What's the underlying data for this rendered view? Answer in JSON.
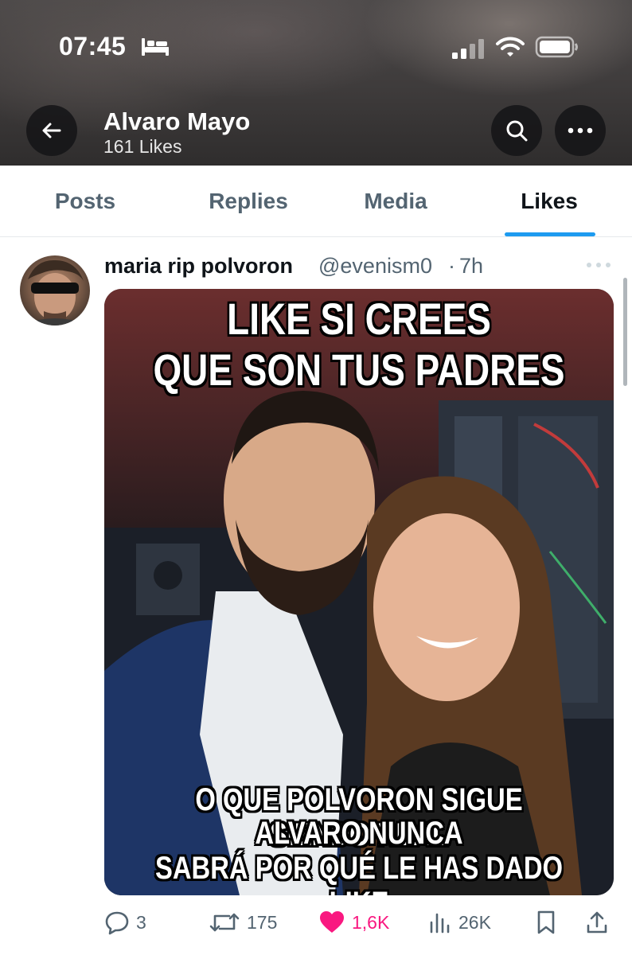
{
  "status_bar": {
    "time": "07:45",
    "icons": [
      "bed-icon",
      "signal-icon",
      "wifi-icon",
      "battery-icon"
    ]
  },
  "header": {
    "name": "Alvaro Mayo",
    "likes_count": "161 Likes",
    "icons": [
      "back-arrow-icon",
      "search-icon",
      "more-icon"
    ]
  },
  "tabs": [
    {
      "label": "Posts",
      "active": false
    },
    {
      "label": "Replies",
      "active": false
    },
    {
      "label": "Media",
      "active": false
    },
    {
      "label": "Likes",
      "active": true
    }
  ],
  "tweet": {
    "author_name": "maria rip polvoron",
    "handle": "@evenism0",
    "separator": "·",
    "time": "7h",
    "media_text": {
      "top_line_1": "LIKE SI CREES",
      "top_line_2": "QUE SON TUS PADRES",
      "bottom_line_1": "O QUE POLVORON SIGUE SIENDO REAL",
      "bottom_line_2": "ALVARO NUNCA",
      "bottom_line_3": "SABRÁ POR QUÉ LE HAS DADO LIKE"
    },
    "actions": {
      "replies": "3",
      "reposts": "175",
      "likes": "1,6K",
      "views": "26K"
    }
  },
  "colors": {
    "accent": "#1d9bf0",
    "like": "#f91880",
    "secondary_text": "#536471",
    "primary_text": "#0f1419"
  }
}
